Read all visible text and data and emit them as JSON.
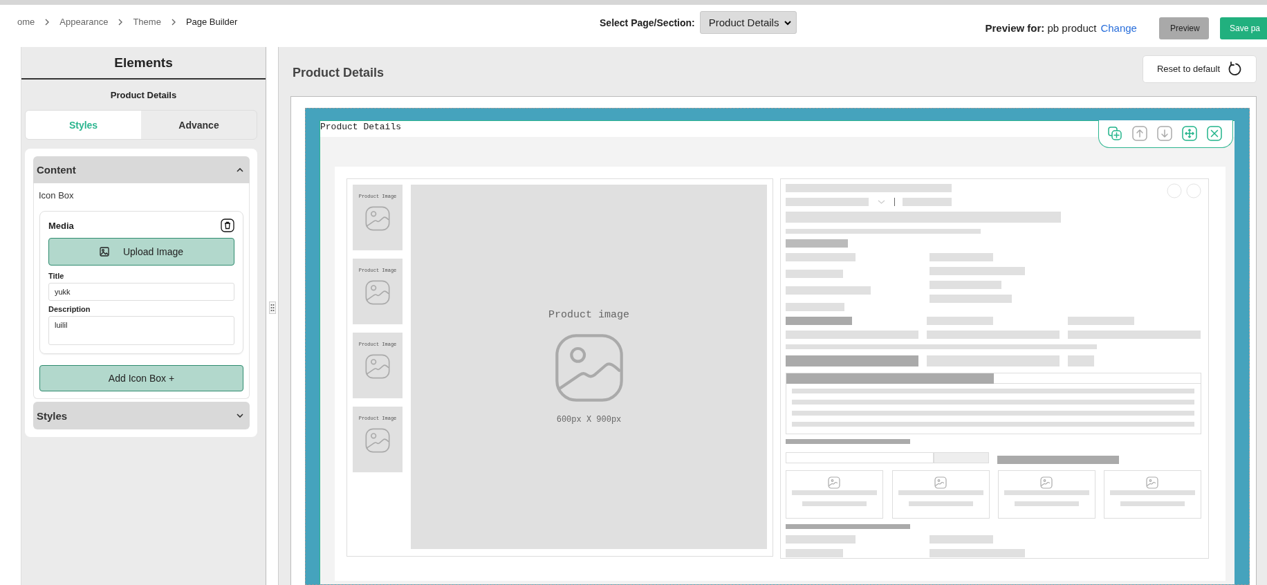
{
  "breadcrumb": [
    {
      "label": "ome",
      "current": false
    },
    {
      "label": "Appearance",
      "current": false
    },
    {
      "label": "Theme",
      "current": false
    },
    {
      "label": "Page Builder",
      "current": true
    }
  ],
  "page_select": {
    "label": "Select Page/Section:",
    "value": "Product Details"
  },
  "preview": {
    "label": "Preview for:",
    "value": "pb product",
    "link": "Change"
  },
  "buttons": [
    {
      "label": "Preview",
      "kind": "secondary"
    },
    {
      "label": "Save pa",
      "kind": "primary"
    }
  ],
  "sidebar": {
    "title": "Elements",
    "subtitle": "Product Details",
    "tabs": [
      {
        "label": "Styles",
        "selected": true
      },
      {
        "label": "Advance",
        "selected": false
      }
    ],
    "sections": [
      {
        "title": "Content",
        "expanded": true,
        "group_label": "Icon Box",
        "items": [
          {
            "title": "Media",
            "upload_button": "Upload Image",
            "fields": [
              {
                "label": "Title",
                "value": "yukk",
                "kind": "input"
              },
              {
                "label": "Description",
                "value": "luilil",
                "kind": "textarea"
              }
            ]
          }
        ],
        "add_button": "Add Icon Box +"
      },
      {
        "title": "Styles",
        "expanded": false
      }
    ]
  },
  "canvas": {
    "title": "Product Details",
    "reset_button": "Reset to default",
    "section": {
      "label": "Product Details",
      "tools": [
        {
          "kind": "duplicate",
          "disabled": false
        },
        {
          "kind": "move_up",
          "disabled": true
        },
        {
          "kind": "move_down",
          "disabled": true
        },
        {
          "kind": "drag",
          "disabled": false
        },
        {
          "kind": "remove",
          "disabled": false
        }
      ],
      "thumbnails": [
        {
          "label": "Product Image"
        },
        {
          "label": "Product Image"
        },
        {
          "label": "Product Image"
        },
        {
          "label": "Product Image"
        }
      ],
      "main_image": {
        "label": "Product image",
        "size": "600px X 900px"
      }
    }
  }
}
